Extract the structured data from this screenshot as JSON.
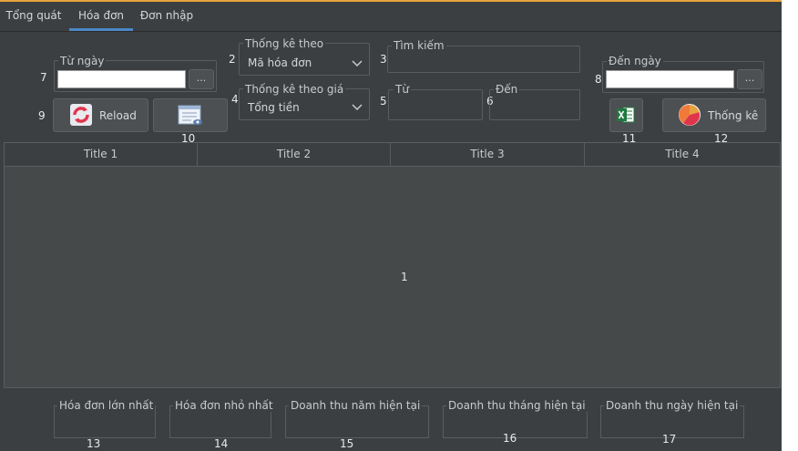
{
  "tabs": [
    {
      "label": "Tổng quát"
    },
    {
      "label": "Hóa đơn"
    },
    {
      "label": "Đơn nhập"
    }
  ],
  "marks": {
    "n1": "1",
    "n2": "2",
    "n3": "3",
    "n4": "4",
    "n5": "5",
    "n6": "6",
    "n7": "7",
    "n8": "8",
    "n9": "9",
    "n10": "10",
    "n11": "11",
    "n12": "12",
    "n13": "13",
    "n14": "14",
    "n15": "15",
    "n16": "16",
    "n17": "17"
  },
  "filters": {
    "from_date_label": "Từ ngày",
    "to_date_label": "Đến ngày",
    "browse_label": "...",
    "stat_by_label": "Thống kê theo",
    "stat_by_value": "Mã hóa đơn",
    "stat_price_label": "Thống kê theo giá",
    "stat_price_value": "Tổng tiền",
    "search_label": "Tìm kiếm",
    "from_label": "Từ",
    "to_label": "Đến"
  },
  "buttons": {
    "reload": "Reload",
    "statistics": "Thống kê"
  },
  "table": {
    "columns": [
      "Title 1",
      "Title 2",
      "Title 3",
      "Title 4"
    ]
  },
  "summary": {
    "max_invoice": "Hóa đơn lớn nhất",
    "min_invoice": "Hóa đơn nhỏ nhất",
    "revenue_year": "Doanh thu năm hiện tại",
    "revenue_month": "Doanh thu tháng hiện tại",
    "revenue_day": "Doanh thu ngày hiện tại"
  },
  "colors": {
    "window_bg": "#3c3f41",
    "accent_top": "#e8a33d",
    "tab_underline": "#4a88c7",
    "excel_green": "#1f7a3e"
  },
  "icons": [
    "reload-icon",
    "preview-icon",
    "excel-icon",
    "pie-chart-icon",
    "chevron-down-icon"
  ]
}
